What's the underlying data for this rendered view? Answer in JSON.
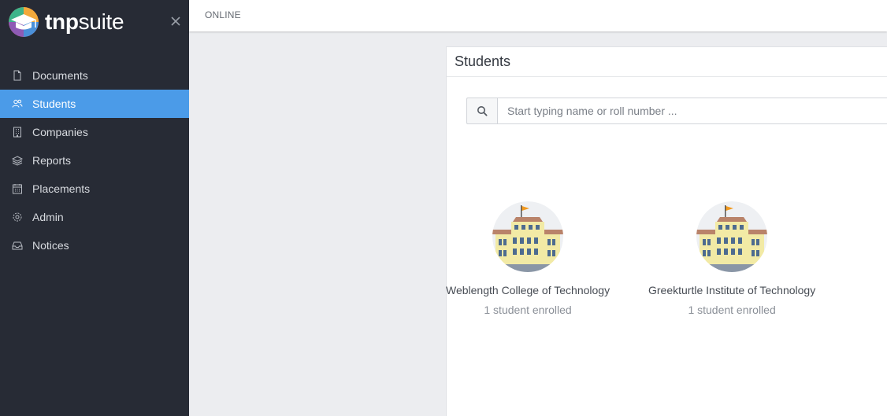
{
  "app": {
    "brand_bold": "tnp",
    "brand_light": "suite"
  },
  "sidebar": {
    "items": [
      {
        "label": "Documents",
        "icon": "document-icon",
        "active": false
      },
      {
        "label": "Students",
        "icon": "users-icon",
        "active": true
      },
      {
        "label": "Companies",
        "icon": "building-icon",
        "active": false
      },
      {
        "label": "Reports",
        "icon": "layers-icon",
        "active": false
      },
      {
        "label": "Placements",
        "icon": "calendar-icon",
        "active": false
      },
      {
        "label": "Admin",
        "icon": "gear-icon",
        "active": false
      },
      {
        "label": "Notices",
        "icon": "inbox-icon",
        "active": false
      }
    ]
  },
  "topbar": {
    "status": "ONLINE"
  },
  "panel": {
    "title": "Students",
    "search": {
      "placeholder": "Start typing name or roll number ..."
    },
    "colleges": [
      {
        "name": "Weblength College of Technology",
        "enrolled": "1 student enrolled"
      },
      {
        "name": "Greekturtle Institute of Technology",
        "enrolled": "1 student enrolled"
      }
    ]
  },
  "colors": {
    "sidebar_bg": "#272b35",
    "active": "#4b9be8",
    "content_bg": "#ecedf0"
  }
}
